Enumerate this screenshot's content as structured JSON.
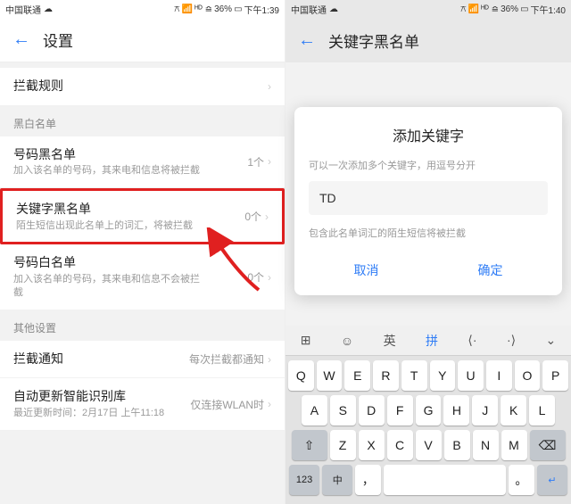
{
  "left": {
    "status": {
      "carrier": "中国联通",
      "cloud": "☁",
      "bt": "⚪",
      "signal": "⁴⁶ᴳ",
      "wifi": "⪮",
      "battery": "36%",
      "time": "下午1:39"
    },
    "header_title": "设置",
    "items": {
      "block_rules": "拦截规则",
      "section_bw": "黑白名单",
      "black_num": {
        "title": "号码黑名单",
        "sub": "加入该名单的号码，其来电和信息将被拦截",
        "val": "1个"
      },
      "keyword_black": {
        "title": "关键字黑名单",
        "sub": "陌生短信出现此名单上的词汇，将被拦截",
        "val": "0个"
      },
      "white_num": {
        "title": "号码白名单",
        "sub": "加入该名单的号码，其来电和信息不会被拦截",
        "val": "0个"
      },
      "section_other": "其他设置",
      "notify": {
        "title": "拦截通知",
        "val": "每次拦截都通知"
      },
      "auto_update": {
        "title": "自动更新智能识别库",
        "sub": "最近更新时间：2月17日 上午11:18",
        "val": "仅连接WLAN时"
      }
    }
  },
  "right": {
    "status": {
      "carrier": "中国联通",
      "cloud": "☁",
      "bt": "⚪",
      "signal": "⁴⁶ᴳ",
      "wifi": "⪮",
      "battery": "36%",
      "time": "下午1:40"
    },
    "header_title": "关键字黑名单",
    "dialog": {
      "title": "添加关键字",
      "hint": "可以一次添加多个关键字，用逗号分开",
      "input_value": "TD",
      "note": "包含此名单词汇的陌生短信将被拦截",
      "cancel": "取消",
      "confirm": "确定"
    },
    "keyboard": {
      "tools": {
        "grid": "⊞",
        "emoji": "☺",
        "en": "英",
        "pin": "拼",
        "left": "⟨·",
        "right": "·⟩",
        "down": "⌄"
      },
      "row1": [
        "Q",
        "W",
        "E",
        "R",
        "T",
        "Y",
        "U",
        "I",
        "O",
        "P"
      ],
      "row2": [
        "A",
        "S",
        "D",
        "F",
        "G",
        "H",
        "J",
        "K",
        "L"
      ],
      "row3_shift": "⇧",
      "row3": [
        "Z",
        "X",
        "C",
        "V",
        "B",
        "N",
        "M"
      ],
      "row3_back": "⌫",
      "row4_num": "123",
      "row4_cn": "中",
      "row4_comma": "，",
      "row4_period": "。",
      "row4_enter": "↵"
    }
  }
}
